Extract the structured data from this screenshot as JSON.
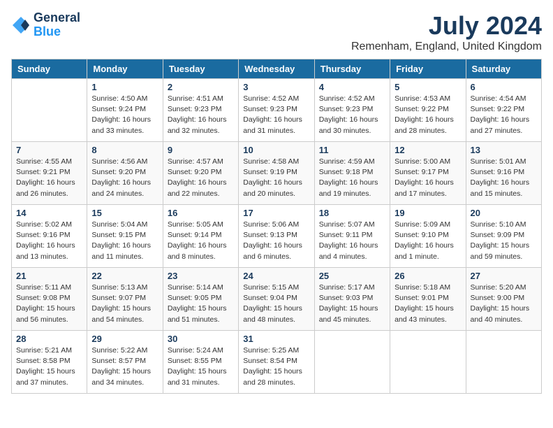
{
  "header": {
    "logo_line1": "General",
    "logo_line2": "Blue",
    "month_title": "July 2024",
    "location": "Remenham, England, United Kingdom"
  },
  "days_of_week": [
    "Sunday",
    "Monday",
    "Tuesday",
    "Wednesday",
    "Thursday",
    "Friday",
    "Saturday"
  ],
  "weeks": [
    [
      {
        "num": "",
        "info": ""
      },
      {
        "num": "1",
        "info": "Sunrise: 4:50 AM\nSunset: 9:24 PM\nDaylight: 16 hours\nand 33 minutes."
      },
      {
        "num": "2",
        "info": "Sunrise: 4:51 AM\nSunset: 9:23 PM\nDaylight: 16 hours\nand 32 minutes."
      },
      {
        "num": "3",
        "info": "Sunrise: 4:52 AM\nSunset: 9:23 PM\nDaylight: 16 hours\nand 31 minutes."
      },
      {
        "num": "4",
        "info": "Sunrise: 4:52 AM\nSunset: 9:23 PM\nDaylight: 16 hours\nand 30 minutes."
      },
      {
        "num": "5",
        "info": "Sunrise: 4:53 AM\nSunset: 9:22 PM\nDaylight: 16 hours\nand 28 minutes."
      },
      {
        "num": "6",
        "info": "Sunrise: 4:54 AM\nSunset: 9:22 PM\nDaylight: 16 hours\nand 27 minutes."
      }
    ],
    [
      {
        "num": "7",
        "info": "Sunrise: 4:55 AM\nSunset: 9:21 PM\nDaylight: 16 hours\nand 26 minutes."
      },
      {
        "num": "8",
        "info": "Sunrise: 4:56 AM\nSunset: 9:20 PM\nDaylight: 16 hours\nand 24 minutes."
      },
      {
        "num": "9",
        "info": "Sunrise: 4:57 AM\nSunset: 9:20 PM\nDaylight: 16 hours\nand 22 minutes."
      },
      {
        "num": "10",
        "info": "Sunrise: 4:58 AM\nSunset: 9:19 PM\nDaylight: 16 hours\nand 20 minutes."
      },
      {
        "num": "11",
        "info": "Sunrise: 4:59 AM\nSunset: 9:18 PM\nDaylight: 16 hours\nand 19 minutes."
      },
      {
        "num": "12",
        "info": "Sunrise: 5:00 AM\nSunset: 9:17 PM\nDaylight: 16 hours\nand 17 minutes."
      },
      {
        "num": "13",
        "info": "Sunrise: 5:01 AM\nSunset: 9:16 PM\nDaylight: 16 hours\nand 15 minutes."
      }
    ],
    [
      {
        "num": "14",
        "info": "Sunrise: 5:02 AM\nSunset: 9:16 PM\nDaylight: 16 hours\nand 13 minutes."
      },
      {
        "num": "15",
        "info": "Sunrise: 5:04 AM\nSunset: 9:15 PM\nDaylight: 16 hours\nand 11 minutes."
      },
      {
        "num": "16",
        "info": "Sunrise: 5:05 AM\nSunset: 9:14 PM\nDaylight: 16 hours\nand 8 minutes."
      },
      {
        "num": "17",
        "info": "Sunrise: 5:06 AM\nSunset: 9:13 PM\nDaylight: 16 hours\nand 6 minutes."
      },
      {
        "num": "18",
        "info": "Sunrise: 5:07 AM\nSunset: 9:11 PM\nDaylight: 16 hours\nand 4 minutes."
      },
      {
        "num": "19",
        "info": "Sunrise: 5:09 AM\nSunset: 9:10 PM\nDaylight: 16 hours\nand 1 minute."
      },
      {
        "num": "20",
        "info": "Sunrise: 5:10 AM\nSunset: 9:09 PM\nDaylight: 15 hours\nand 59 minutes."
      }
    ],
    [
      {
        "num": "21",
        "info": "Sunrise: 5:11 AM\nSunset: 9:08 PM\nDaylight: 15 hours\nand 56 minutes."
      },
      {
        "num": "22",
        "info": "Sunrise: 5:13 AM\nSunset: 9:07 PM\nDaylight: 15 hours\nand 54 minutes."
      },
      {
        "num": "23",
        "info": "Sunrise: 5:14 AM\nSunset: 9:05 PM\nDaylight: 15 hours\nand 51 minutes."
      },
      {
        "num": "24",
        "info": "Sunrise: 5:15 AM\nSunset: 9:04 PM\nDaylight: 15 hours\nand 48 minutes."
      },
      {
        "num": "25",
        "info": "Sunrise: 5:17 AM\nSunset: 9:03 PM\nDaylight: 15 hours\nand 45 minutes."
      },
      {
        "num": "26",
        "info": "Sunrise: 5:18 AM\nSunset: 9:01 PM\nDaylight: 15 hours\nand 43 minutes."
      },
      {
        "num": "27",
        "info": "Sunrise: 5:20 AM\nSunset: 9:00 PM\nDaylight: 15 hours\nand 40 minutes."
      }
    ],
    [
      {
        "num": "28",
        "info": "Sunrise: 5:21 AM\nSunset: 8:58 PM\nDaylight: 15 hours\nand 37 minutes."
      },
      {
        "num": "29",
        "info": "Sunrise: 5:22 AM\nSunset: 8:57 PM\nDaylight: 15 hours\nand 34 minutes."
      },
      {
        "num": "30",
        "info": "Sunrise: 5:24 AM\nSunset: 8:55 PM\nDaylight: 15 hours\nand 31 minutes."
      },
      {
        "num": "31",
        "info": "Sunrise: 5:25 AM\nSunset: 8:54 PM\nDaylight: 15 hours\nand 28 minutes."
      },
      {
        "num": "",
        "info": ""
      },
      {
        "num": "",
        "info": ""
      },
      {
        "num": "",
        "info": ""
      }
    ]
  ]
}
